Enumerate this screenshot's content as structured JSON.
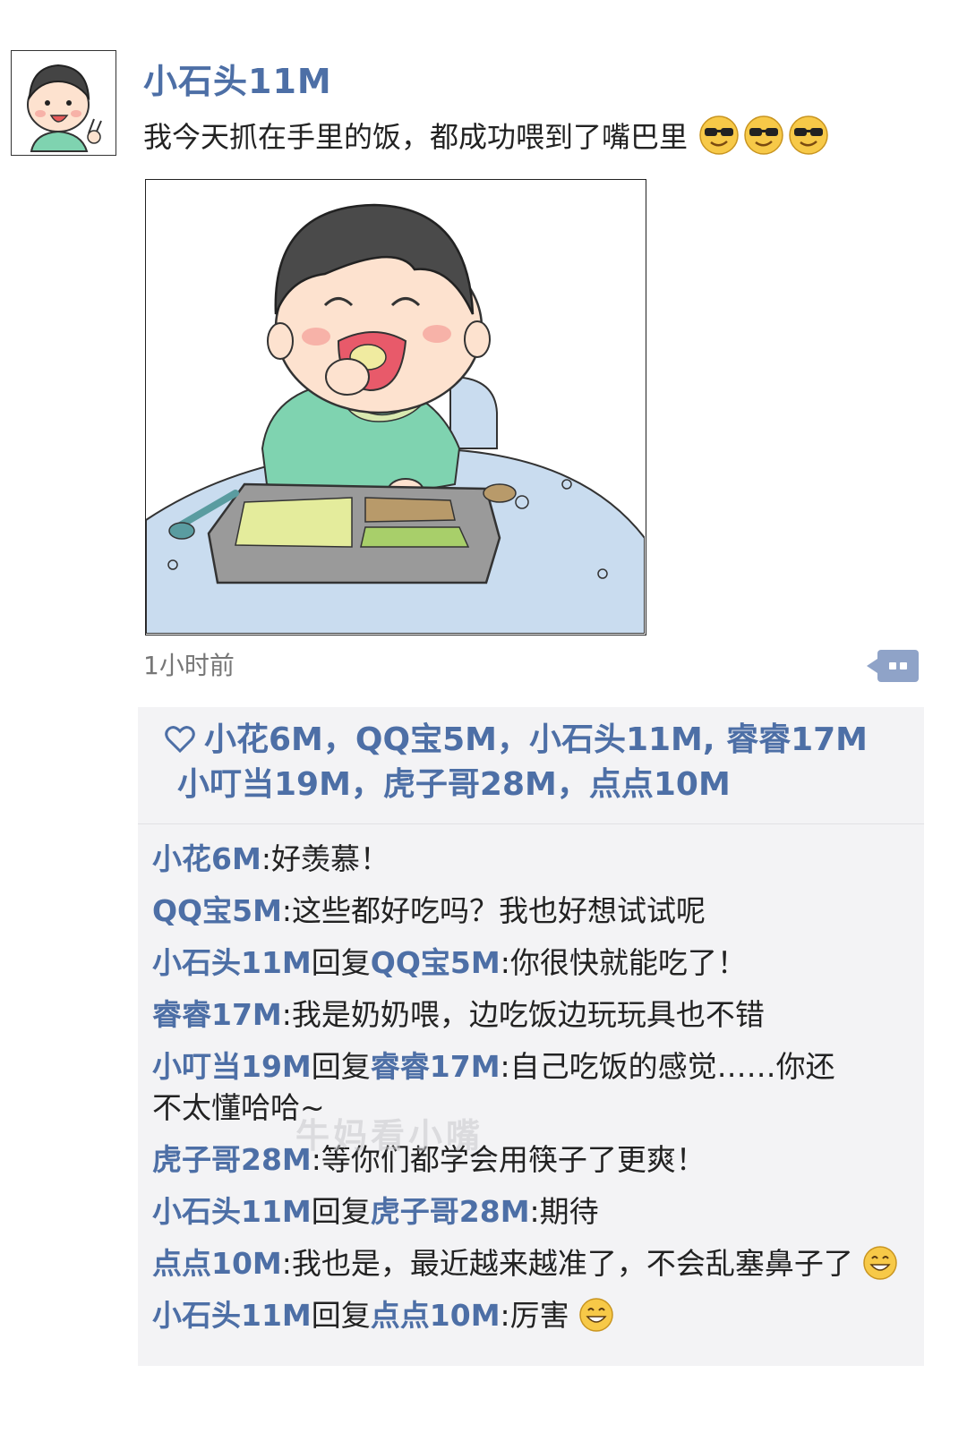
{
  "post": {
    "author": "小石头11M",
    "text": "我今天抓在手里的饭，都成功喂到了嘴巴里",
    "emojis": [
      "cool-face-emoji",
      "cool-face-emoji",
      "cool-face-emoji"
    ],
    "timestamp": "1小时前"
  },
  "likes": {
    "line1": "小花6M，QQ宝5M，小石头11M, 睿睿17M",
    "line2": "小叮当19M，虎子哥28M，点点10M"
  },
  "comments": [
    {
      "name": "小花6M",
      "text": "好羡慕！"
    },
    {
      "name": "QQ宝5M",
      "text": "这些都好吃吗？我也好想试试呢"
    },
    {
      "name": "小石头11M",
      "reply_word": "回复",
      "reply_to": "QQ宝5M",
      "text": "你很快就能吃了！"
    },
    {
      "name": "睿睿17M",
      "text": "我是奶奶喂，边吃饭边玩玩具也不错"
    },
    {
      "name": "小叮当19M",
      "reply_word": "回复",
      "reply_to": "睿睿17M",
      "text": "自己吃饭的感觉……你还不太懂哈哈~"
    },
    {
      "name": "虎子哥28M",
      "text": "等你们都学会用筷子了更爽！"
    },
    {
      "name": "小石头11M",
      "reply_word": "回复",
      "reply_to": "虎子哥28M",
      "text": "期待"
    },
    {
      "name": "点点10M",
      "text": "我也是，最近越来越准了，不会乱塞鼻子了",
      "emoji": "grin-emoji"
    },
    {
      "name": "小石头11M",
      "reply_word": "回复",
      "reply_to": "点点10M",
      "text": "厉害",
      "emoji": "grin-emoji"
    }
  ],
  "watermark": "牛妈看小嘴",
  "colors": {
    "name_blue": "#4d6fa6",
    "panel_bg": "#f3f3f5",
    "table_blue": "#c9dcef"
  }
}
